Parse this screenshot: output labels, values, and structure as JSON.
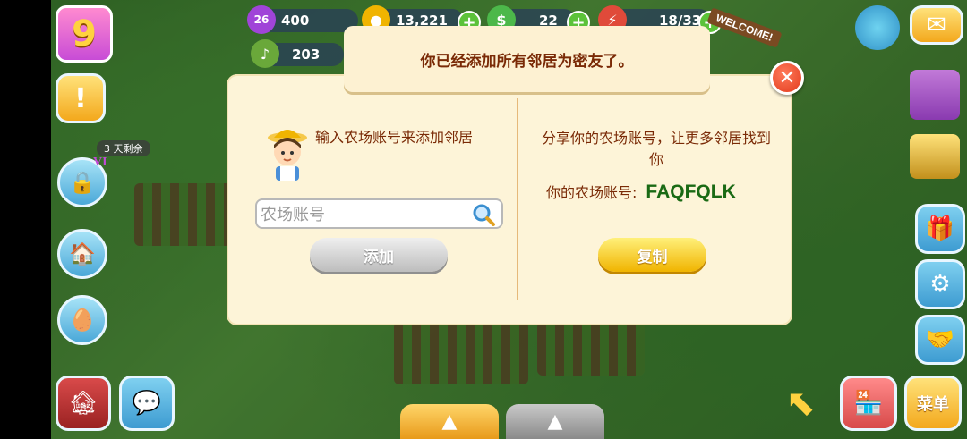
{
  "hud": {
    "level": "9",
    "stars": "26",
    "xp": "400",
    "coins": "13,221",
    "cash": "22",
    "energy": "18/33",
    "music": "203",
    "vip_timer": "3 天剩余",
    "vip_label": "VI",
    "welcome_sign": "WELCOME!",
    "menu_label": "菜单"
  },
  "notice": {
    "text": "你已经添加所有邻居为密友了。"
  },
  "dialog": {
    "left_title": "输入农场账号来添加邻居",
    "search_placeholder": "农场账号",
    "add_button": "添加",
    "right_title": "分享你的农场账号，让更多邻居找到你",
    "account_label": "你的农场账号:",
    "account_code": "FAQFQLK",
    "copy_button": "复制"
  },
  "colors": {
    "dialog_bg": "#fdf4d8",
    "text_brown": "#7a2a06",
    "code_green": "#1a6a14",
    "copy_yellow": "#f0b400",
    "close_red": "#e23a1c"
  }
}
